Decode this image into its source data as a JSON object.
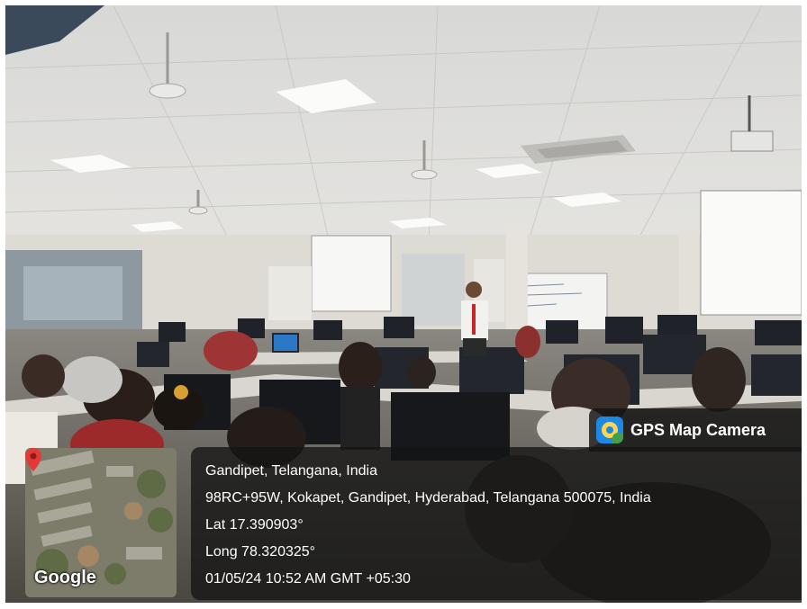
{
  "badge": {
    "title": "GPS Map Camera",
    "icon": "gps-map-camera-icon"
  },
  "location": {
    "place": "Gandipet, Telangana, India",
    "address": "98RC+95W, Kokapet, Gandipet, Hyderabad, Telangana 500075, India",
    "latitude": "Lat 17.390903°",
    "longitude": "Long 78.320325°",
    "timestamp": "01/05/24 10:52 AM GMT +05:30"
  },
  "map": {
    "provider": "Google",
    "pin_icon": "location-pin-icon",
    "pin_color": "#e53935"
  }
}
